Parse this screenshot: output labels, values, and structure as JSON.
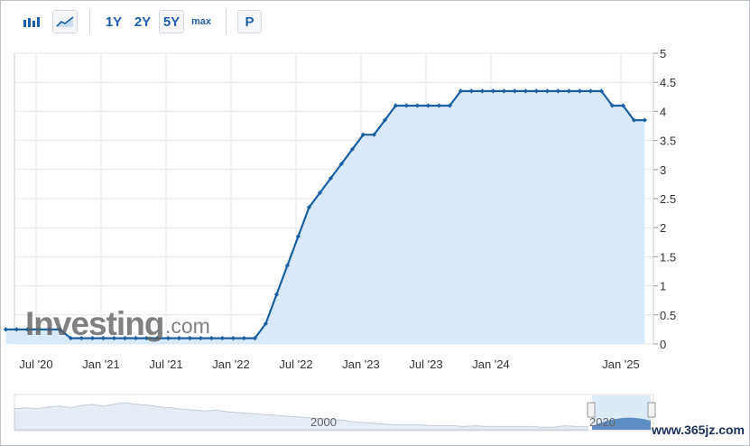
{
  "toolbar": {
    "bar_chart_icon": "bar-chart-icon",
    "area_chart_icon": "area-chart-icon",
    "ranges": [
      "1Y",
      "2Y",
      "5Y",
      "max"
    ],
    "selected_range": "5Y",
    "p_button": "P"
  },
  "watermark": {
    "brand": "Investing",
    "suffix": ".com",
    "site": "www.365jz.com"
  },
  "navigator": {
    "labels": [
      "2000",
      "2020"
    ]
  },
  "colors": {
    "line": "#1b5fa3",
    "fill": "#d7e9fb",
    "grid": "#e4e6e9",
    "axis_text": "#333333",
    "accent": "#1f5fa8"
  },
  "chart_data": {
    "type": "area",
    "x_tick_labels": [
      "Jul '20",
      "Jan '21",
      "Jul '21",
      "Jan '22",
      "Jul '22",
      "Jan '23",
      "Jul '23",
      "Jan '24",
      "Jan '25"
    ],
    "y_tick_labels": [
      "0",
      "0.5",
      "1",
      "1.5",
      "2",
      "2.5",
      "3",
      "3.5",
      "4",
      "4.5",
      "5"
    ],
    "ylim": [
      0,
      5
    ],
    "y_axis_side": "right",
    "grid": true,
    "series": [
      {
        "x": [
          "2020-04",
          "2020-05",
          "2020-06",
          "2020-07",
          "2020-08",
          "2020-09",
          "2020-10",
          "2020-11",
          "2020-12",
          "2021-01",
          "2021-02",
          "2021-03",
          "2021-04",
          "2021-05",
          "2021-06",
          "2021-07",
          "2021-08",
          "2021-09",
          "2021-10",
          "2021-11",
          "2021-12",
          "2022-01",
          "2022-02",
          "2022-03",
          "2022-04",
          "2022-05",
          "2022-06",
          "2022-07",
          "2022-08",
          "2022-09",
          "2022-10",
          "2022-11",
          "2022-12",
          "2023-01",
          "2023-02",
          "2023-03",
          "2023-04",
          "2023-05",
          "2023-06",
          "2023-07",
          "2023-08",
          "2023-09",
          "2023-10",
          "2023-11",
          "2023-12",
          "2024-01",
          "2024-02",
          "2024-03",
          "2024-04",
          "2024-05",
          "2024-06",
          "2024-07",
          "2024-08",
          "2024-09",
          "2024-10",
          "2024-11",
          "2024-12",
          "2025-01",
          "2025-02",
          "2025-03"
        ],
        "values": [
          0.25,
          0.25,
          0.25,
          0.25,
          0.25,
          0.25,
          0.1,
          0.1,
          0.1,
          0.1,
          0.1,
          0.1,
          0.1,
          0.1,
          0.1,
          0.1,
          0.1,
          0.1,
          0.1,
          0.1,
          0.1,
          0.1,
          0.1,
          0.1,
          0.35,
          0.85,
          1.35,
          1.85,
          2.35,
          2.6,
          2.85,
          3.1,
          3.35,
          3.6,
          3.6,
          3.85,
          4.1,
          4.1,
          4.1,
          4.1,
          4.1,
          4.1,
          4.35,
          4.35,
          4.35,
          4.35,
          4.35,
          4.35,
          4.35,
          4.35,
          4.35,
          4.35,
          4.35,
          4.35,
          4.35,
          4.35,
          4.1,
          4.1,
          3.85,
          3.85
        ]
      }
    ]
  }
}
